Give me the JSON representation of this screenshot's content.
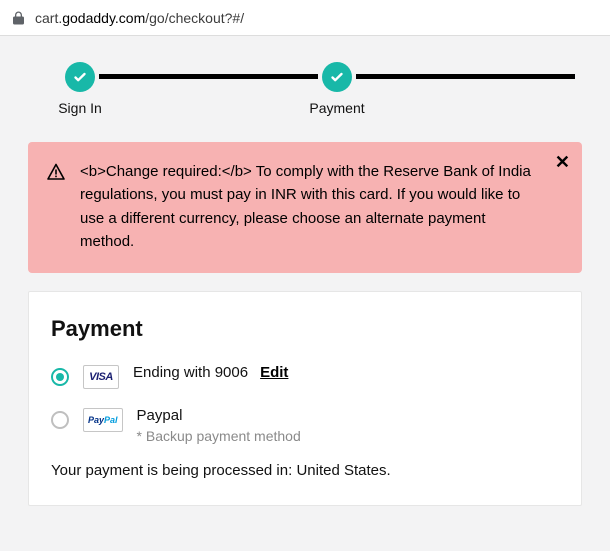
{
  "addressbar": {
    "url_prefix": "cart.",
    "url_host": "godaddy.com",
    "url_path": "/go/checkout?#/"
  },
  "stepper": {
    "step1": "Sign In",
    "step2": "Payment"
  },
  "alert": {
    "message": "<b>Change required:</b> To comply with the Reserve Bank of India regulations, you must pay in INR with this card. If you would like to use a different currency, please choose an alternate payment method."
  },
  "payment": {
    "title": "Payment",
    "option1": {
      "brand": "VISA",
      "ending": "Ending with 9006",
      "edit": "Edit"
    },
    "option2": {
      "brand_pay": "Pay",
      "brand_pal": "Pal",
      "name": "Paypal",
      "backup": "* Backup payment method"
    },
    "processing_prefix": "Your payment is being processed in: ",
    "processing_country": "United States."
  }
}
